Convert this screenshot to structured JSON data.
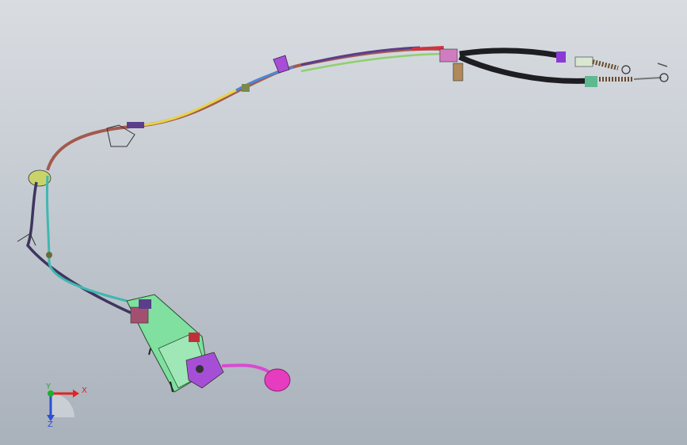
{
  "viewport": {
    "background_top": "#d9dde2",
    "background_bottom": "#a9b1bb"
  },
  "triad": {
    "x_label": "X",
    "y_label": "Y",
    "z_label": "Z",
    "x_color": "#e02424",
    "y_color": "#1fae2e",
    "z_color": "#2a4fd6"
  },
  "model": {
    "cable_colors": {
      "upper_outer": "#a35a4e",
      "upper_yellow": "#e8d34a",
      "upper_blue": "#4d86d6",
      "upper_purple": "#5a3e8c",
      "upper_green": "#8fd06e",
      "lower_dark": "#3f3560",
      "lower_teal": "#3fb8b0",
      "end_black": "#1d1d22",
      "shifter_body": "#7fe0a0",
      "knob": "#e63cc0",
      "bracket": "#a64fd6"
    }
  }
}
